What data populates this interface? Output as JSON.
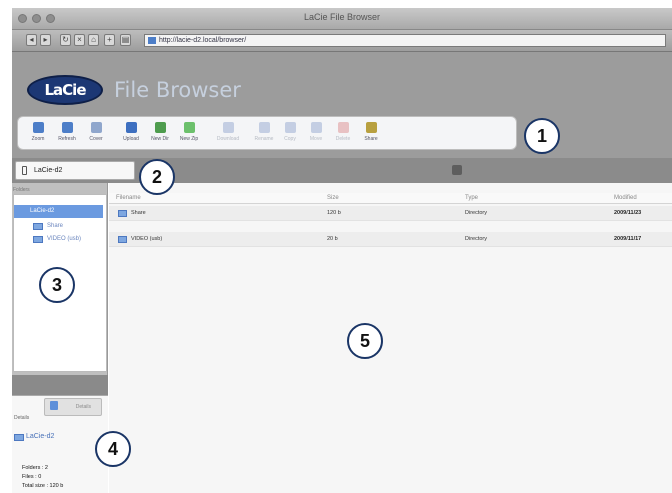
{
  "window": {
    "title": "LaCie File Browser"
  },
  "address": {
    "url": "http://lacie-d2.local/browser/"
  },
  "app": {
    "logo_text": "LaCie",
    "title": "File Browser"
  },
  "toolbar": {
    "buttons": [
      {
        "label": "Zoom",
        "icon": "zoom-icon",
        "color": "#4d7ec8",
        "disabled": false
      },
      {
        "label": "Refresh",
        "icon": "refresh-icon",
        "color": "#4d7ec8",
        "disabled": false
      },
      {
        "label": "Cover",
        "icon": "cover-icon",
        "color": "#8fa6cc",
        "disabled": false
      },
      {
        "label": "Upload",
        "icon": "upload-icon",
        "color": "#3d6fc0",
        "disabled": false
      },
      {
        "label": "New Dir",
        "icon": "new-dir-icon",
        "color": "#4e9c4e",
        "disabled": false
      },
      {
        "label": "New Zip",
        "icon": "new-zip-icon",
        "color": "#6cc06c",
        "disabled": false
      },
      {
        "label": "Download",
        "icon": "download-icon",
        "color": "#6b86be",
        "disabled": true
      },
      {
        "label": "Rename",
        "icon": "rename-icon",
        "color": "#6b86be",
        "disabled": true
      },
      {
        "label": "Copy",
        "icon": "copy-icon",
        "color": "#6b86be",
        "disabled": true
      },
      {
        "label": "Move",
        "icon": "move-icon",
        "color": "#6b86be",
        "disabled": true
      },
      {
        "label": "Delete",
        "icon": "delete-icon",
        "color": "#d06060",
        "disabled": true
      },
      {
        "label": "Share",
        "icon": "share-icon",
        "color": "#b8a040",
        "disabled": false
      }
    ]
  },
  "path": {
    "value": "LaCie-d2"
  },
  "tree": {
    "header": "Folders",
    "root": "LaCie-d2",
    "items": [
      "Share",
      "VIDEO (usb)"
    ]
  },
  "details": {
    "header": "Details",
    "button_label": "Details",
    "name": "LaCie-d2",
    "stats": [
      "Folders : 2",
      "Files : 0",
      "Total size : 120 b"
    ]
  },
  "list": {
    "columns": [
      "Filename",
      "Size",
      "Type",
      "Modified"
    ],
    "rows": [
      {
        "name": "Share",
        "size": "120 b",
        "type": "Directory",
        "modified": "2009/11/23"
      },
      {
        "name": "VIDEO (usb)",
        "size": "20 b",
        "type": "Directory",
        "modified": "2009/11/17"
      }
    ]
  },
  "callouts": [
    "1",
    "2",
    "3",
    "4",
    "5"
  ],
  "colors": {
    "accent": "#4d7ec8",
    "selection": "#6b9ae0",
    "callout_border": "#1a3566",
    "logo": "#1c3774"
  }
}
